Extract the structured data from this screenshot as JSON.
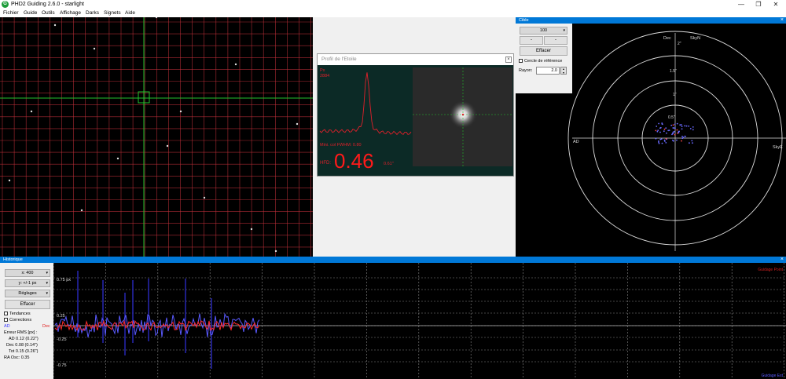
{
  "window": {
    "title": "PHD2 Guiding 2.6.0 - starlight",
    "minimize": "—",
    "maximize": "❐",
    "close": "✕"
  },
  "menu": [
    "Fichier",
    "Guide",
    "Outils",
    "Affichage",
    "Darks",
    "Signets",
    "Aide"
  ],
  "profile": {
    "title": "Profil de l'Etoile",
    "px_label": "Px",
    "px_value": "2884",
    "fwhm": "Mini. col FWHM: 0.80",
    "hfd_label": "HFD:",
    "hfd_value": "0.46",
    "hfd_arcsec": "0.61\"",
    "close": "×"
  },
  "cible": {
    "title": "Cible",
    "zoom": "100",
    "btn_minus": "-",
    "btn_small": "-",
    "clear": "Effacer",
    "ref_circle": "Cercle de référence",
    "radius_label": "Rayon:",
    "radius_value": "2.0",
    "labels": {
      "dec": "Dec",
      "skyn": "SkyN",
      "ad": "AD",
      "skye": "SkyE"
    },
    "rings": [
      "2\"",
      "1.5\"",
      "1\"",
      "0.5\""
    ],
    "close": "×"
  },
  "history": {
    "title": "Historique",
    "x_scale": "x: 400",
    "y_scale": "y: +/-1 px",
    "settings": "Réglages",
    "clear": "Effacer",
    "trends": "Tendances",
    "corrections": "Corrections",
    "ad_label": "AD",
    "dec_label": "Dec",
    "rms_title": "Erreur RMS [px] :",
    "rms_ad": "AD  0.12 (0.22\")",
    "rms_dec": "Dec  0.08 (0.14\")",
    "rms_tot": "Tot  0.15 (0.26\")",
    "ra_osc": "RA Osc: 0.35",
    "ytick_labels": [
      "0.75 px",
      "0.25",
      "-0.25",
      "-0.75"
    ],
    "right_top": "Guidage Point",
    "right_bottom": "Guidage Est",
    "close": "×"
  },
  "colors": {
    "grid_red": "#c8323c",
    "grid_green": "#22c22e",
    "ad_blue": "#5a5aff",
    "dec_red": "#ff2a2a",
    "profile_red": "#e0202a",
    "accent_blue": "#0078d7"
  }
}
